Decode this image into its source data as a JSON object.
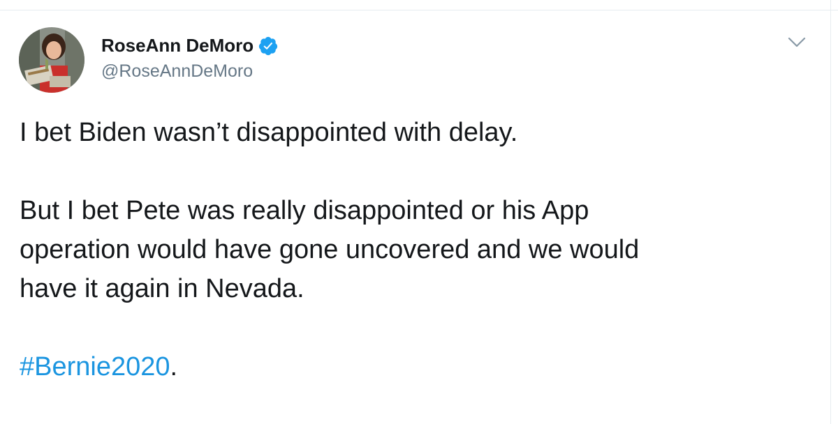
{
  "tweet": {
    "display_name": "RoseAnn DeMoro",
    "handle": "@RoseAnnDeMoro",
    "lines": {
      "l1": "I bet Biden wasn’t disappointed with delay.",
      "l2": "But I bet Pete was really disappointed or his App",
      "l3": "operation would have gone uncovered and we would",
      "l4": "have it again in Nevada."
    },
    "hashtag": "#Bernie2020",
    "hashtag_suffix": "."
  },
  "icons": {
    "verified": "verified-badge-icon",
    "caret": "chevron-down-icon"
  },
  "colors": {
    "link": "#1b95e0",
    "verified": "#1da1f2",
    "secondary_text": "#657786",
    "primary_text": "#14171a"
  }
}
